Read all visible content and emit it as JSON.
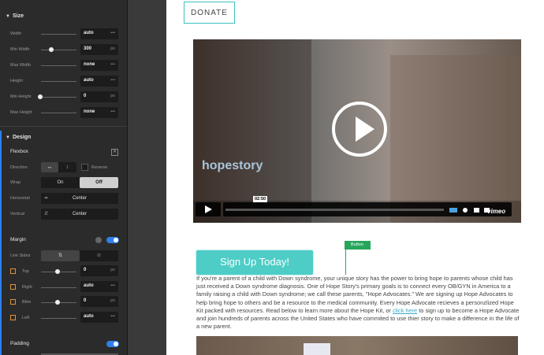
{
  "panel": {
    "size_section": "Size",
    "design_section": "Design",
    "flexbox_label": "Flexbox",
    "size_rows": [
      {
        "label": "Width",
        "value": "auto",
        "unit": "•••",
        "slider": false
      },
      {
        "label": "Min Width",
        "value": "300",
        "unit": "px",
        "slider": true
      },
      {
        "label": "Max Width",
        "value": "none",
        "unit": "•••",
        "slider": false
      },
      {
        "label": "Height",
        "value": "auto",
        "unit": "•••",
        "slider": false
      },
      {
        "label": "Min Height",
        "value": "0",
        "unit": "px",
        "slider": true
      },
      {
        "label": "Max Height",
        "value": "none",
        "unit": "•••",
        "slider": false
      }
    ],
    "direction_label": "Direction",
    "reverse_label": "Reverse",
    "wrap_label": "Wrap",
    "wrap_on": "On",
    "wrap_off": "Off",
    "horizontal_label": "Horizontal",
    "horizontal_value": "Center",
    "vertical_label": "Vertical",
    "vertical_value": "Center",
    "margin_label": "Margin",
    "link_sides_label": "Link Sides",
    "margin_rows": [
      {
        "label": "Top",
        "value": "0",
        "unit": "px"
      },
      {
        "label": "Right",
        "value": "auto",
        "unit": "•••"
      },
      {
        "label": "Bttm",
        "value": "0",
        "unit": "px"
      },
      {
        "label": "Left",
        "value": "auto",
        "unit": "•••"
      }
    ],
    "padding_label": "Padding"
  },
  "canvas": {
    "donate": "DONATE",
    "video_brand": "hopestory",
    "video_time": "02:50",
    "video_logo": "vimeo",
    "button_tag": "Button",
    "signup": "Sign Up Today!",
    "para_1": "If you're a parent of a child with Down syndrome, your unique story has the power to bring hope to parents whose child has just received a Down syndrome diagnosis. One of Hope Story's primary goals is to connect every OB/GYN in America to a family raising a child with Down syndrome; we call these parents, \"Hope Advocates.\" We are signing up Hope Advocates to help bring hope to others and be a resource to the medical community. Every Hope Advocate recieves a personzlized Hope Kit packed with resources. Read below to learn more about the Hope Kit, or ",
    "para_link": "click here",
    "para_2": " to sign up to become a Hope Advocate and join hundreds of parents across the United States who have commited to use thier story to make a difference in the life of a new parent."
  },
  "colors": {
    "accent": "#2f80ed",
    "teal": "#4ecdc6",
    "tag_green": "#27a65b"
  }
}
